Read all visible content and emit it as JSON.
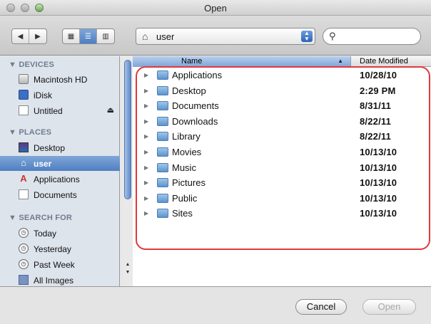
{
  "window": {
    "title": "Open"
  },
  "toolbar": {
    "back_icon": "◀",
    "forward_icon": "▶",
    "icon_view_glyph": "▦",
    "list_view_glyph": "☰",
    "column_view_glyph": "▥",
    "path_label": "user",
    "search_placeholder": ""
  },
  "sidebar": {
    "sections": {
      "devices": "▼ DEVICES",
      "places": "▼ PLACES",
      "search_for": "▼ SEARCH FOR"
    },
    "devices": [
      {
        "label": "Macintosh HD",
        "icon": "hard-drive-icon"
      },
      {
        "label": "iDisk",
        "icon": "idisk-icon"
      },
      {
        "label": "Untitled",
        "icon": "external-drive-icon",
        "eject": "⏏"
      }
    ],
    "places": [
      {
        "label": "Desktop",
        "icon": "desktop-icon"
      },
      {
        "label": "user",
        "icon": "home-icon",
        "selected": true
      },
      {
        "label": "Applications",
        "icon": "applications-icon"
      },
      {
        "label": "Documents",
        "icon": "documents-icon"
      }
    ],
    "search_for": [
      {
        "label": "Today",
        "icon": "clock-icon"
      },
      {
        "label": "Yesterday",
        "icon": "clock-icon"
      },
      {
        "label": "Past Week",
        "icon": "clock-icon"
      },
      {
        "label": "All Images",
        "icon": "images-icon"
      }
    ]
  },
  "file_list": {
    "columns": {
      "name": "Name",
      "date_modified": "Date Modified"
    },
    "rows": [
      {
        "name": "Applications",
        "date": "10/28/10"
      },
      {
        "name": "Desktop",
        "date": "2:29 PM"
      },
      {
        "name": "Documents",
        "date": "8/31/11"
      },
      {
        "name": "Downloads",
        "date": "8/22/11"
      },
      {
        "name": "Library",
        "date": "8/22/11"
      },
      {
        "name": "Movies",
        "date": "10/13/10"
      },
      {
        "name": "Music",
        "date": "10/13/10"
      },
      {
        "name": "Pictures",
        "date": "10/13/10"
      },
      {
        "name": "Public",
        "date": "10/13/10"
      },
      {
        "name": "Sites",
        "date": "10/13/10"
      }
    ]
  },
  "buttons": {
    "cancel": "Cancel",
    "open": "Open"
  },
  "colors": {
    "selection": "#4f7fc1",
    "highlight_outline": "#e03a3a",
    "sidebar_bg": "#dee4ec"
  }
}
